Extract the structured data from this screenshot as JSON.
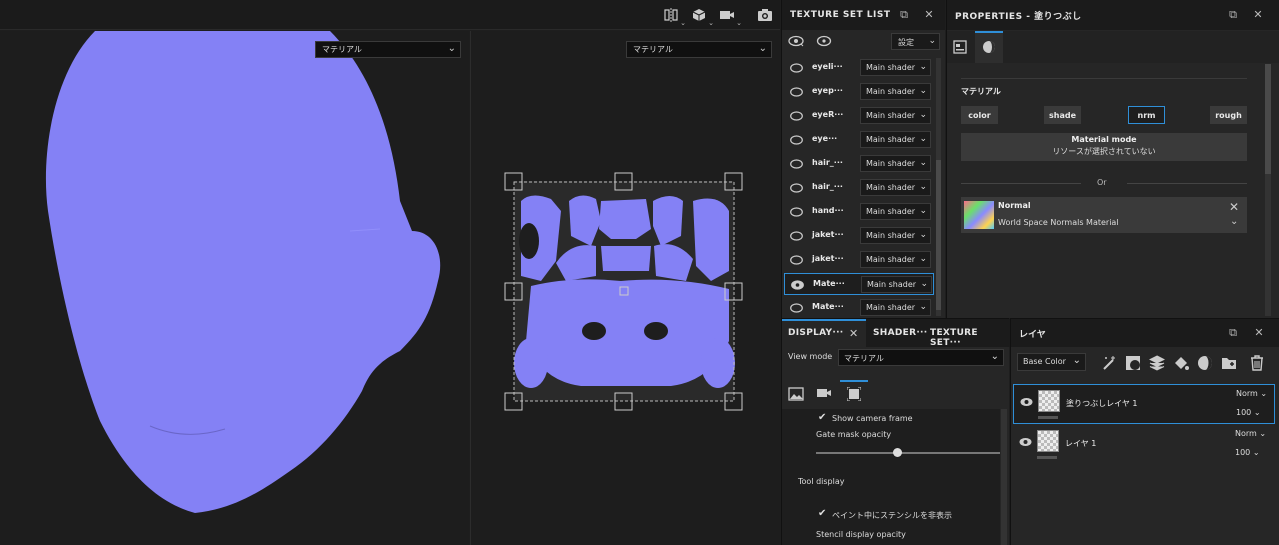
{
  "viewport3d": {
    "material_select": "マテリアル"
  },
  "viewport2d": {
    "material_select": "マテリアル"
  },
  "texture_set_list": {
    "title": "TEXTURE SET LIST",
    "settings_label": "設定",
    "rows": [
      {
        "name": "eyeli···",
        "shader": "Main shader"
      },
      {
        "name": "eyep···",
        "shader": "Main shader"
      },
      {
        "name": "eyeR···",
        "shader": "Main shader"
      },
      {
        "name": "eye···",
        "shader": "Main shader"
      },
      {
        "name": "hair_···",
        "shader": "Main shader"
      },
      {
        "name": "hair_···",
        "shader": "Main shader"
      },
      {
        "name": "hand···",
        "shader": "Main shader"
      },
      {
        "name": "jaket···",
        "shader": "Main shader"
      },
      {
        "name": "jaket···",
        "shader": "Main shader"
      },
      {
        "name": "Mate···",
        "shader": "Main shader"
      },
      {
        "name": "Mate···",
        "shader": "Main shader"
      }
    ]
  },
  "properties": {
    "title": "PROPERTIES - 塗りつぶし",
    "section": "マテリアル",
    "channels": [
      "color",
      "shade",
      "nrm",
      "rough"
    ],
    "material_mode_label": "Material mode",
    "material_mode_value": "リソースが選択されていない",
    "or_label": "Or",
    "material_name": "Normal",
    "material_desc": "World Space Normals Material"
  },
  "display": {
    "tabs": [
      "DISPLAY···",
      "SHADER···",
      "TEXTURE SET···"
    ],
    "view_mode_label": "View mode",
    "view_mode_value": "マテリアル",
    "show_camera_frame": "Show camera frame",
    "gate_mask_opacity": "Gate mask opacity",
    "gate_mask_value": 0.44,
    "tool_display": "Tool display",
    "hide_stencil": "ペイント中にステンシルを非表示",
    "stencil_display_opacity": "Stencil display opacity"
  },
  "layers": {
    "title": "レイヤ",
    "channel_select": "Base Color",
    "items": [
      {
        "name": "塗りつぶしレイヤ 1",
        "blend": "Norm",
        "opacity": "100"
      },
      {
        "name": "レイヤ 1",
        "blend": "Norm",
        "opacity": "100"
      }
    ]
  },
  "colors": {
    "normal_map": "#8481f5",
    "accent": "#2f8fd8"
  }
}
